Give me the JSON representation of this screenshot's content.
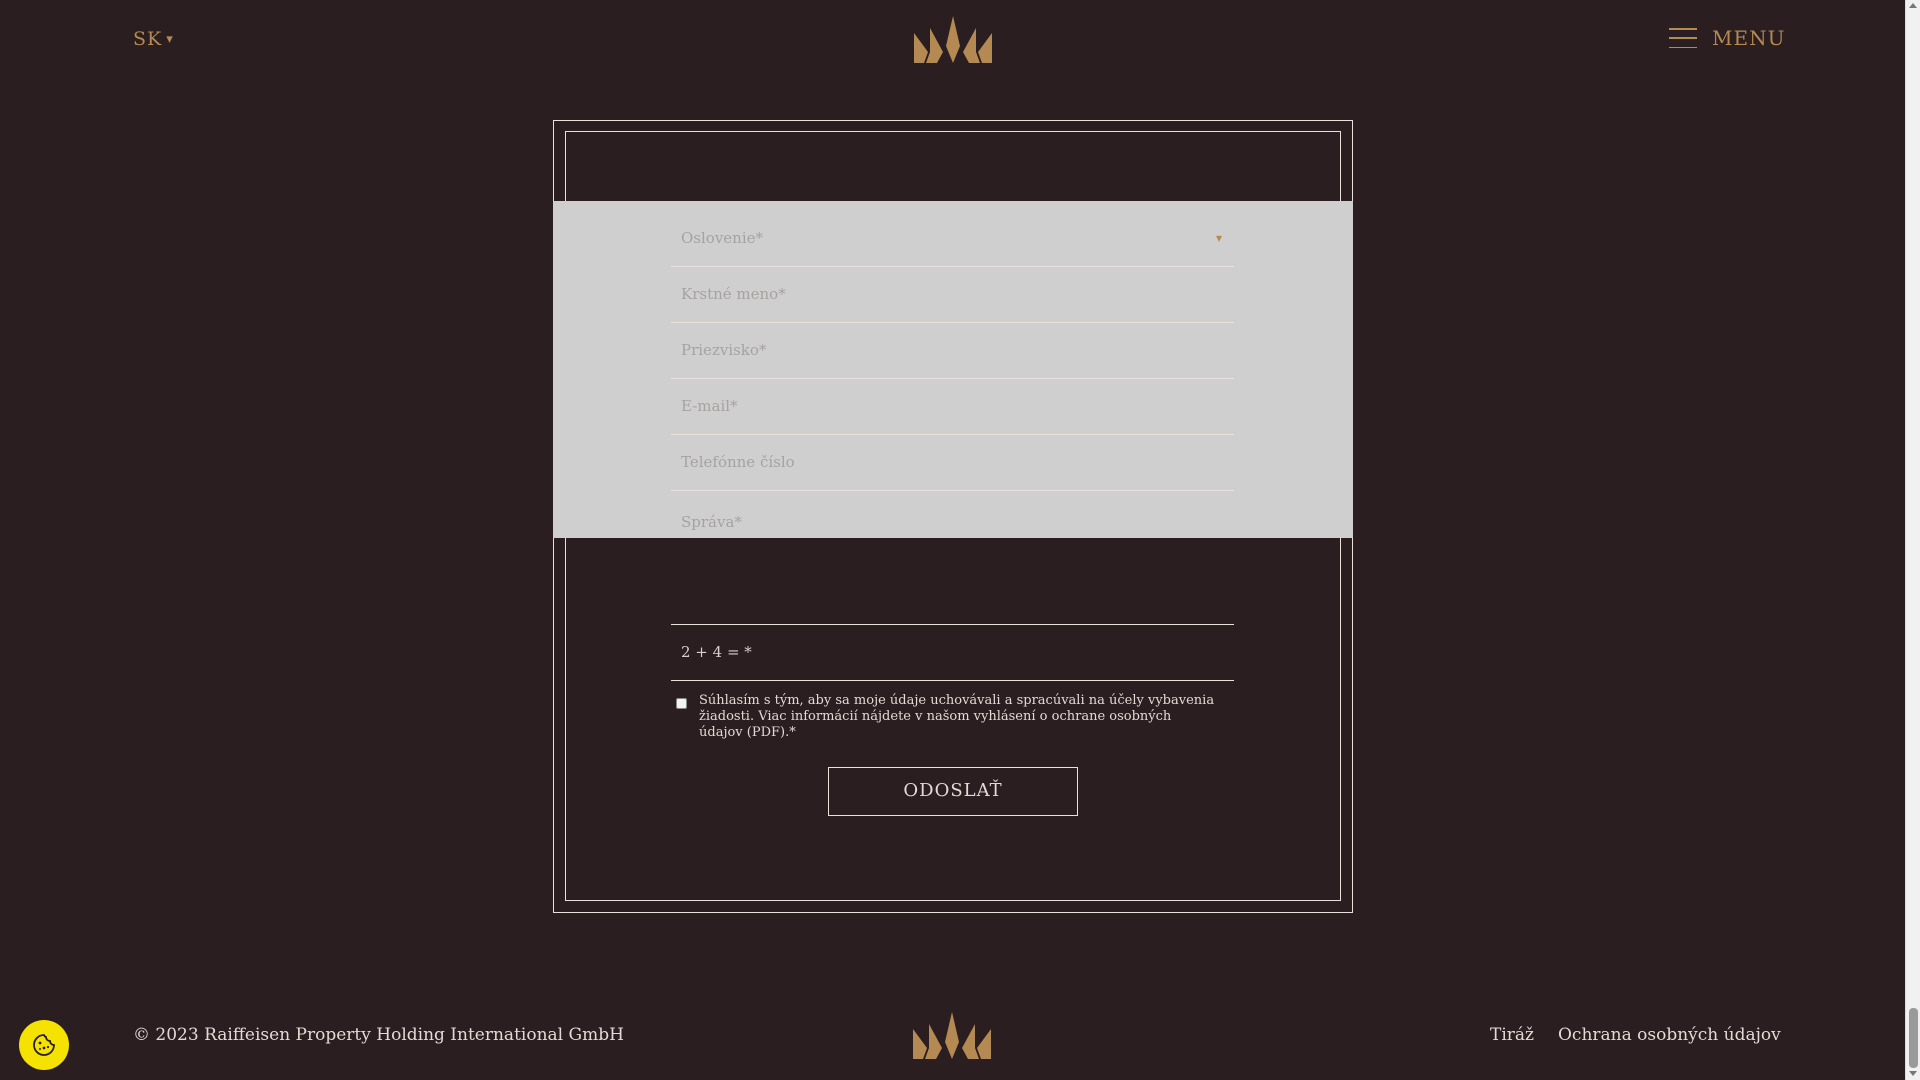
{
  "header": {
    "language": "SK",
    "language_caret": "▾",
    "menu_label": "MENU"
  },
  "form": {
    "salutation_placeholder": "Oslovenie*",
    "salutation_arrow": "▾",
    "first_name_placeholder": "Krstné meno*",
    "last_name_placeholder": "Priezvisko*",
    "email_placeholder": "E-mail*",
    "phone_placeholder": "Telefónne číslo",
    "message_placeholder": "Správa*",
    "captcha_label": "2 + 4 = *",
    "consent_text": "Súhlasím s tým, aby sa moje údaje uchovávali a spracúvali na účely vybavenia žiadosti. Viac informácií nájdete v našom vyhlásení o ochrane osobných údajov (PDF).*",
    "submit_label": "ODOSLAŤ"
  },
  "footer": {
    "copyright": "© 2023 Raiffeisen Property Holding International GmbH",
    "links": [
      "Tiráž",
      "Ochrana osobných údajov"
    ]
  },
  "colors": {
    "background": "#2a1e20",
    "gold_accent": "#b58a52",
    "frame_line": "#e9e2dc",
    "overlay_grey": "#cfcfcf",
    "cookie_yellow": "#f6e200"
  },
  "icons": {
    "logo": "crown-logo-icon",
    "menu": "hamburger-icon",
    "cookie": "cookie-icon"
  }
}
